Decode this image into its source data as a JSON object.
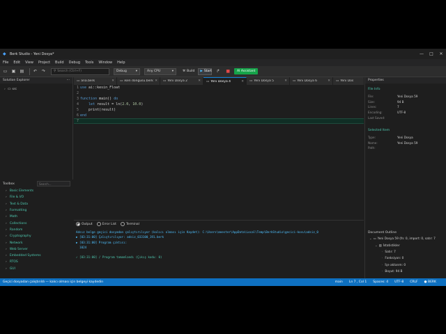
{
  "window": {
    "title": "Berk Studio - Yeni Dosya*",
    "controls": [
      "—",
      "□",
      "✕"
    ]
  },
  "menu": [
    "File",
    "Edit",
    "View",
    "Project",
    "Build",
    "Debug",
    "Tools",
    "Window",
    "Help"
  ],
  "toolbar": {
    "search_placeholder": "Search (Ctrl+F)",
    "config": "Debug",
    "platform": "Any CPU",
    "build_label": "Build",
    "run_label": "Start",
    "ai_label": "AI Assistant"
  },
  "solution_explorer": {
    "title": "Solution Explorer",
    "items": [
      {
        "label": "src"
      }
    ]
  },
  "toolbox": {
    "title": "Toolbox",
    "search_placeholder": "Search...",
    "categories": [
      "Basic Elements",
      "File & I/O",
      "Text & Data",
      "Formatting",
      "Math",
      "Collections",
      "Random",
      "Cryptography",
      "Network",
      "Web Server",
      "Embedded Systems",
      "RTOS",
      "GUI"
    ]
  },
  "tabs": [
    {
      "label": "ana.berk",
      "active": false
    },
    {
      "label": "iken döngüsü.berk",
      "active": false
    },
    {
      "label": "Yeni Dosya 2",
      "active": false
    },
    {
      "label": "Yeni Dosya 4",
      "active": true
    },
    {
      "label": "Yeni Dosya 5",
      "active": false
    },
    {
      "label": "Yeni Dosya 6",
      "active": false
    },
    {
      "label": "Yeni Dos",
      "active": false
    }
  ],
  "editor": {
    "lines": [
      {
        "n": "1",
        "code": "use ai::kesin_Float"
      },
      {
        "n": "2",
        "code": ""
      },
      {
        "n": "3",
        "code": "function main() do"
      },
      {
        "n": "4",
        "code": "    let result = ln(2.0, 10.0)"
      },
      {
        "n": "5",
        "code": "    print(result)"
      },
      {
        "n": "6",
        "code": "end"
      },
      {
        "n": "7",
        "code": ""
      }
    ],
    "current_line": 7
  },
  "output_tabs": [
    {
      "label": "Output",
      "selected": true
    },
    {
      "label": "Error List",
      "selected": false
    },
    {
      "label": "Terminal",
      "selected": false
    }
  ],
  "output": {
    "lines": [
      {
        "text": "Adsız belge geçici dosyadan çalıştırılıyor (kalıcı olması için Kaydet): C:\\Users\\meester\\AppData\\Local\\Temp\\BerkStudio\\gecici-kosu\\adsiz_0",
        "ok": false
      },
      {
        "text": "▶ [03:31:00] Çalıştırılıyor: adsiz_033100_191.berk",
        "ok": false
      },
      {
        "text": "▶ [03:31:00] Program çıktısı:",
        "ok": false
      },
      {
        "text": "  1024",
        "ok": false
      },
      {
        "text": "",
        "ok": false
      },
      {
        "text": "✓ [03:31:00] / Program tamamlandı (Çıkış kodu: 0)",
        "ok": true
      }
    ]
  },
  "properties": {
    "title": "Properties",
    "file_info_title": "File Info",
    "file_info": [
      {
        "k": "File:",
        "v": "Yeni Dosya 59"
      },
      {
        "k": "Size:",
        "v": "94 B"
      },
      {
        "k": "Lines:",
        "v": "7"
      },
      {
        "k": "Encoding:",
        "v": "UTF-8"
      },
      {
        "k": "Last Saved:",
        "v": ""
      }
    ],
    "selected_title": "Selected Item",
    "selected": [
      {
        "k": "Type:",
        "v": "Yeni Dosya"
      },
      {
        "k": "Name:",
        "v": "Yeni Dosya 59"
      },
      {
        "k": "Path:",
        "v": ""
      }
    ]
  },
  "outline": {
    "title": "Document Outline",
    "root": "Yeni Dosya 59  (fn: 0, import: 0, satır: 7",
    "group": "İstatistikler",
    "stats": [
      "Satır: 7",
      "Fonksiyon: 0",
      "İçe aktarım: 0",
      "Boyut: 94 B"
    ]
  },
  "status": {
    "message": "Geçici dosyadan çalıştırıldı — kalıcı olması için belgeyi kaydedin",
    "branch": "main",
    "position": "Ln 7 , Col 1",
    "indent": "Spaces: 4",
    "encoding": "UTF-8",
    "eol": "CRLF",
    "language": "● BERK"
  }
}
